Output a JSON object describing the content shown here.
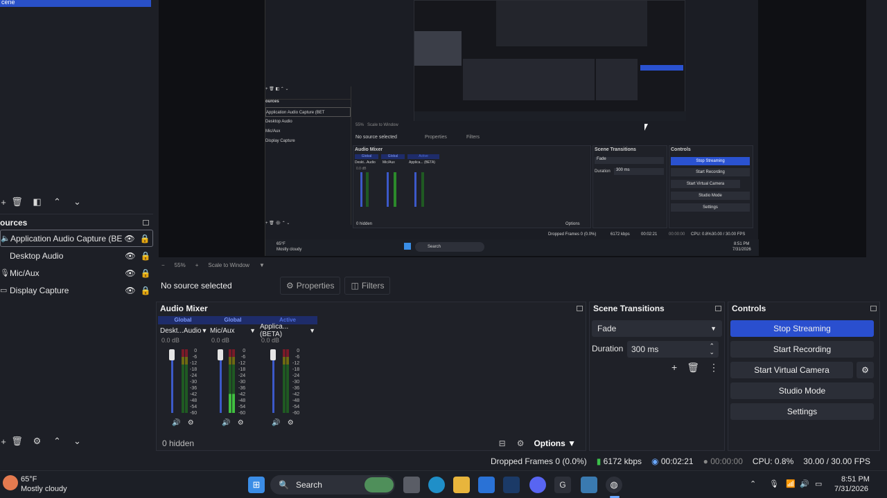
{
  "sources": {
    "title": "ources",
    "items": [
      {
        "label": "Application Audio Capture (BET",
        "icon": "speaker-icon"
      },
      {
        "label": "Desktop Audio",
        "icon": "speaker-icon"
      },
      {
        "label": "Mic/Aux",
        "icon": "mic-icon"
      },
      {
        "label": "Display Capture",
        "icon": "monitor-icon"
      }
    ]
  },
  "scene_selected_label": "cene",
  "preview": {
    "zoom": "55%",
    "scale_mode": "Scale to Window",
    "inner": {
      "sources_title": "ources",
      "items": [
        "Application Audio Capture (BET",
        "Desktop Audio",
        "Mic/Aux",
        "Display Capture"
      ],
      "zoom": "55%",
      "scale_mode": "Scale to Window",
      "no_source": "No source selected",
      "properties": "Properties",
      "filters": "Filters",
      "audio_mixer": "Audio Mixer",
      "ch1": "Deskt...Audio",
      "ch2": "Mic/Aux",
      "ch3": "Applica... (BETA)",
      "tag1": "Global",
      "tag2": "Global",
      "tag3": "Active",
      "db": "0.0 dB",
      "hidden": "0 hidden",
      "options": "Options",
      "scene_transitions": "Scene Transitions",
      "fade": "Fade",
      "duration": "Duration",
      "duration_val": "300 ms",
      "controls": "Controls",
      "stop_streaming": "Stop Streaming",
      "start_recording": "Start Recording",
      "start_virtual_camera": "Start Virtual Camera",
      "studio_mode": "Studio Mode",
      "settings": "Settings",
      "dropped": "Dropped Frames 0 (0.0%)",
      "kbps": "6172 kbps",
      "stream_time": "00:02:21",
      "rec_time": "00:00:00",
      "cpu": "CPU: 0.8%",
      "fps": "30.00 / 30.00 FPS",
      "weather_temp": "65°F",
      "weather_desc": "Mostly cloudy",
      "search": "Search",
      "clock_time": "8:51 PM",
      "clock_date": "7/31/2026"
    }
  },
  "source_bar": {
    "no_source": "No source selected",
    "properties": "Properties",
    "filters": "Filters"
  },
  "mixer": {
    "title": "Audio Mixer",
    "channels": [
      {
        "tag": "Global",
        "name": "Deskt...Audio",
        "db": "0.0 dB"
      },
      {
        "tag": "Global",
        "name": "Mic/Aux",
        "db": "0.0 dB"
      },
      {
        "tag": "Active",
        "name": "Applica... (BETA)",
        "db": "0.0 dB"
      }
    ],
    "scale": [
      "0",
      "-6",
      "-12",
      "-18",
      "-24",
      "-30",
      "-36",
      "-42",
      "-48",
      "-54",
      "-60"
    ],
    "hidden": "0 hidden",
    "options": "Options"
  },
  "transitions": {
    "title": "Scene Transitions",
    "selected": "Fade",
    "duration_label": "Duration",
    "duration_value": "300 ms"
  },
  "controls": {
    "title": "Controls",
    "stop_streaming": "Stop Streaming",
    "start_recording": "Start Recording",
    "start_virtual_camera": "Start Virtual Camera",
    "studio_mode": "Studio Mode",
    "settings": "Settings"
  },
  "status": {
    "dropped": "Dropped Frames 0 (0.0%)",
    "kbps": "6172 kbps",
    "stream_time": "00:02:21",
    "rec_time": "00:00:00",
    "cpu": "CPU: 0.8%",
    "fps": "30.00 / 30.00 FPS"
  },
  "taskbar": {
    "weather_temp": "65°F",
    "weather_desc": "Mostly cloudy",
    "search": "Search",
    "time": "8:51 PM",
    "date": "7/31/2026"
  },
  "colors": {
    "accent": "#2a4fcf",
    "bg": "#1d1f26"
  }
}
